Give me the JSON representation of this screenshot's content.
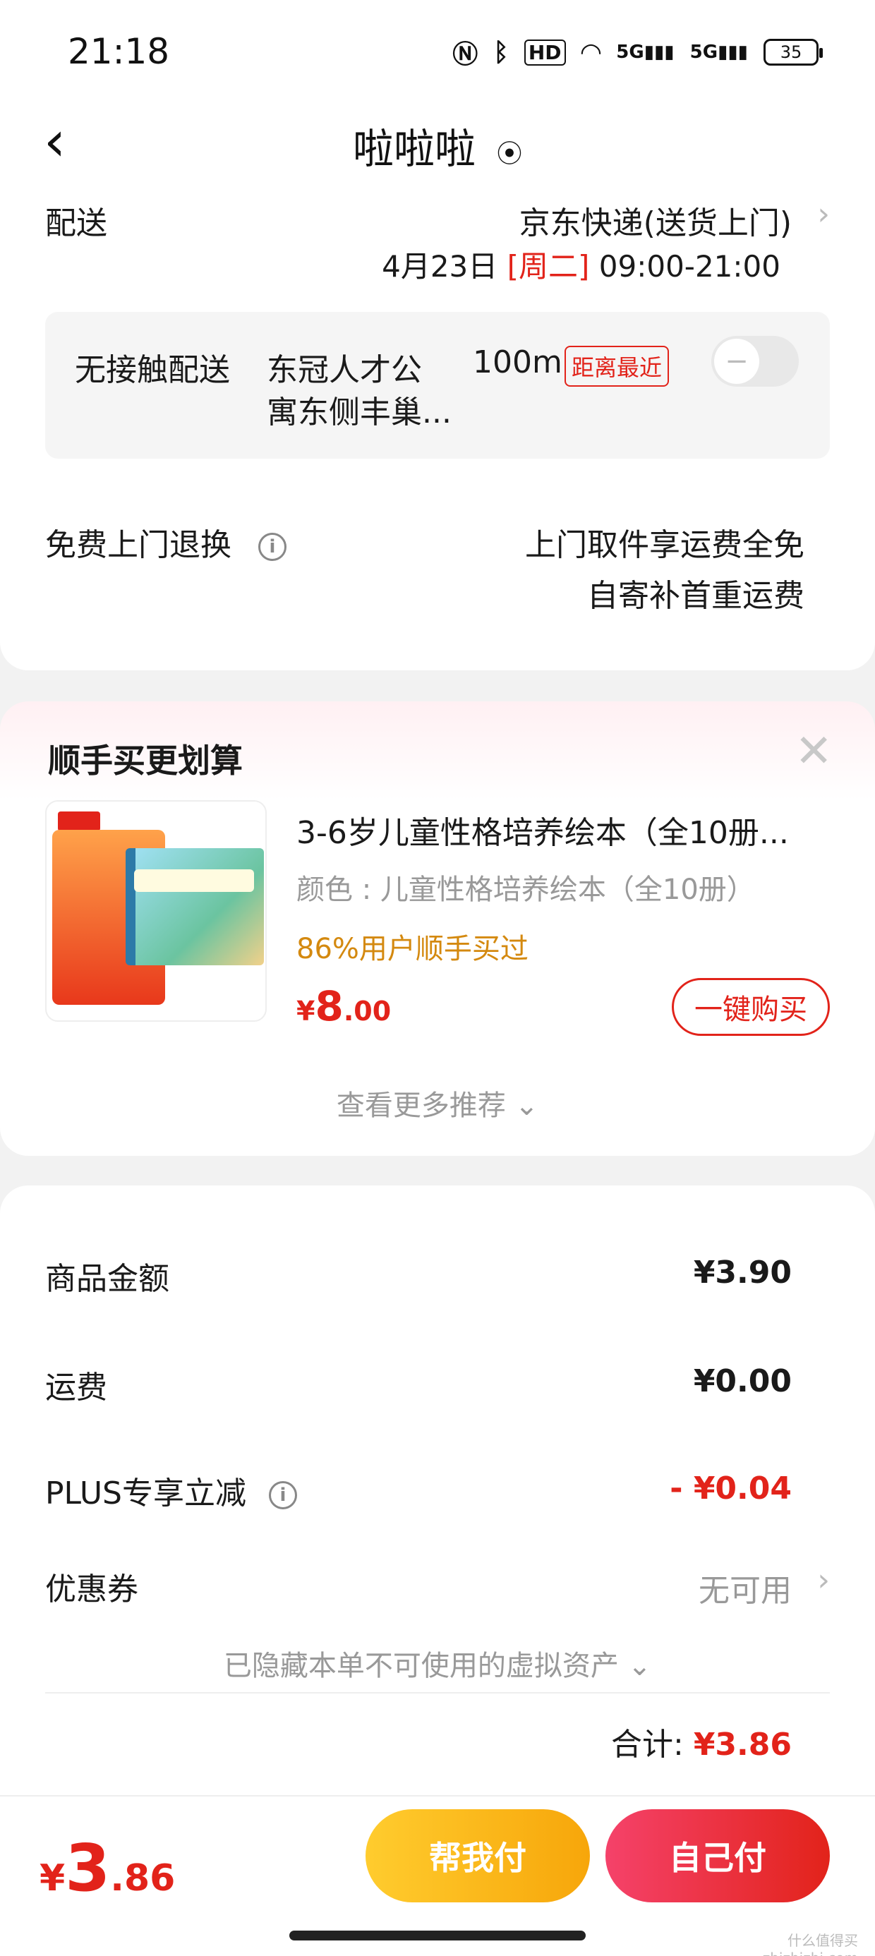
{
  "status_bar": {
    "time": "21:18",
    "icons": [
      "nfc-icon",
      "bluetooth-icon",
      "hd-icon",
      "wifi-icon",
      "5g-signal-icon",
      "5g-signal-icon"
    ],
    "hd": "HD",
    "5g_1": "5G",
    "5g_2": "5G",
    "battery": "35"
  },
  "header": {
    "back": "‹",
    "title": "啦啦啦"
  },
  "delivery": {
    "label": "配送",
    "method": "京东快递(送货上门)",
    "date": "4月23日",
    "weekday": "[周二]",
    "time_range": "09:00-21:00",
    "no_contact": {
      "label": "无接触配送",
      "location_line1": "东冠人才公",
      "location_line2": "寓东侧丰巢...",
      "distance": "100m",
      "tag": "距离最近"
    },
    "return_label": "免费上门退换",
    "return_line1": "上门取件享运费全免",
    "return_line2": "自寄补首重运费"
  },
  "recommend": {
    "title": "顺手买更划算",
    "product": {
      "name": "3-6岁儿童性格培养绘本（全10册...",
      "spec": "颜色 : 儿童性格培养绘本（全10册）",
      "bought": "86%用户顺手买过",
      "price_symbol": "¥",
      "price_int": "8",
      "price_dec": ".00",
      "buy_button": "一键购买"
    },
    "more": "查看更多推荐 ⌄"
  },
  "price_detail": {
    "goods_label": "商品金额",
    "goods_value": "¥3.90",
    "shipping_label": "运费",
    "shipping_value": "¥0.00",
    "plus_label": "PLUS专享立减",
    "plus_value": "- ¥0.04",
    "coupon_label": "优惠券",
    "coupon_value": "无可用",
    "hidden_assets": "已隐藏本单不可使用的虚拟资产 ⌄",
    "total_label": "合计: ",
    "total_value": "¥3.86"
  },
  "bottom": {
    "price_symbol": "¥",
    "price_int": "3",
    "price_dec": ".86",
    "help_pay": "帮我付",
    "self_pay": "自己付"
  },
  "watermark": "什么值得买\nzhizhizhi.com",
  "colors": {
    "accent_red": "#e2231a",
    "orange_text": "#d4890f",
    "help_button": "#f7a60a"
  }
}
